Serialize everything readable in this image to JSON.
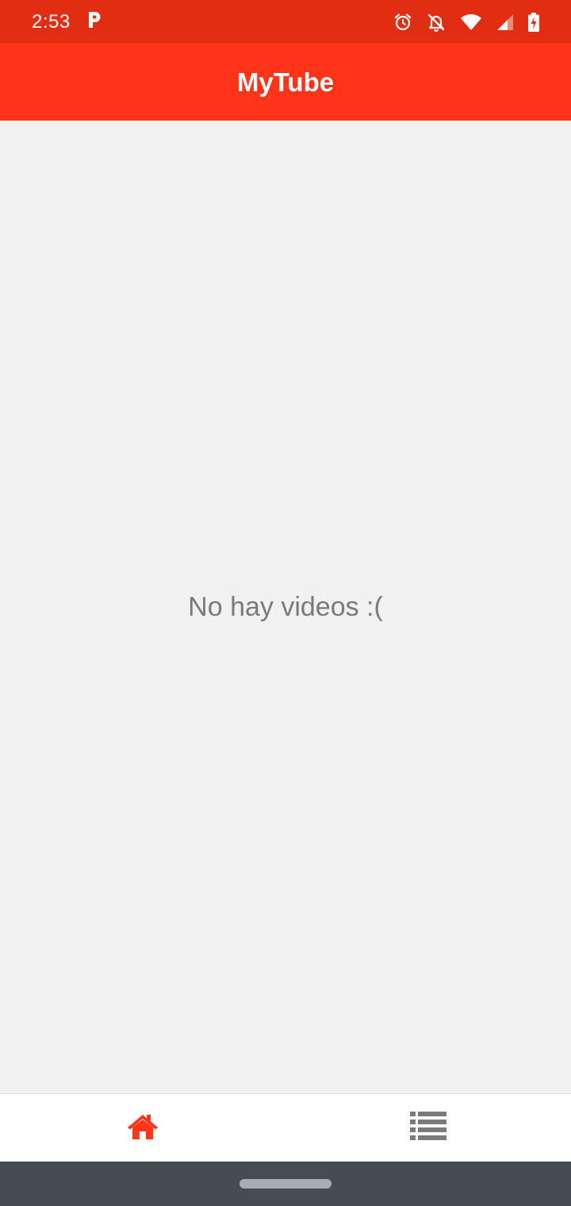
{
  "status_bar": {
    "time": "2:53",
    "icons": [
      "parking-app-icon",
      "alarm-icon",
      "notifications-off-icon",
      "wifi-icon",
      "cell-signal-icon",
      "battery-charging-icon"
    ]
  },
  "app_bar": {
    "title": "MyTube"
  },
  "main": {
    "empty_message": "No hay videos :("
  },
  "bottom_nav": {
    "items": [
      {
        "icon": "home-icon",
        "active": true,
        "color": "#ff3419"
      },
      {
        "icon": "list-icon",
        "active": false,
        "color": "#7a7a7a"
      }
    ]
  },
  "colors": {
    "status_bar": "#e12d12",
    "app_bar": "#ff3419",
    "background": "#f1f1f1",
    "system_nav": "#454c52"
  }
}
